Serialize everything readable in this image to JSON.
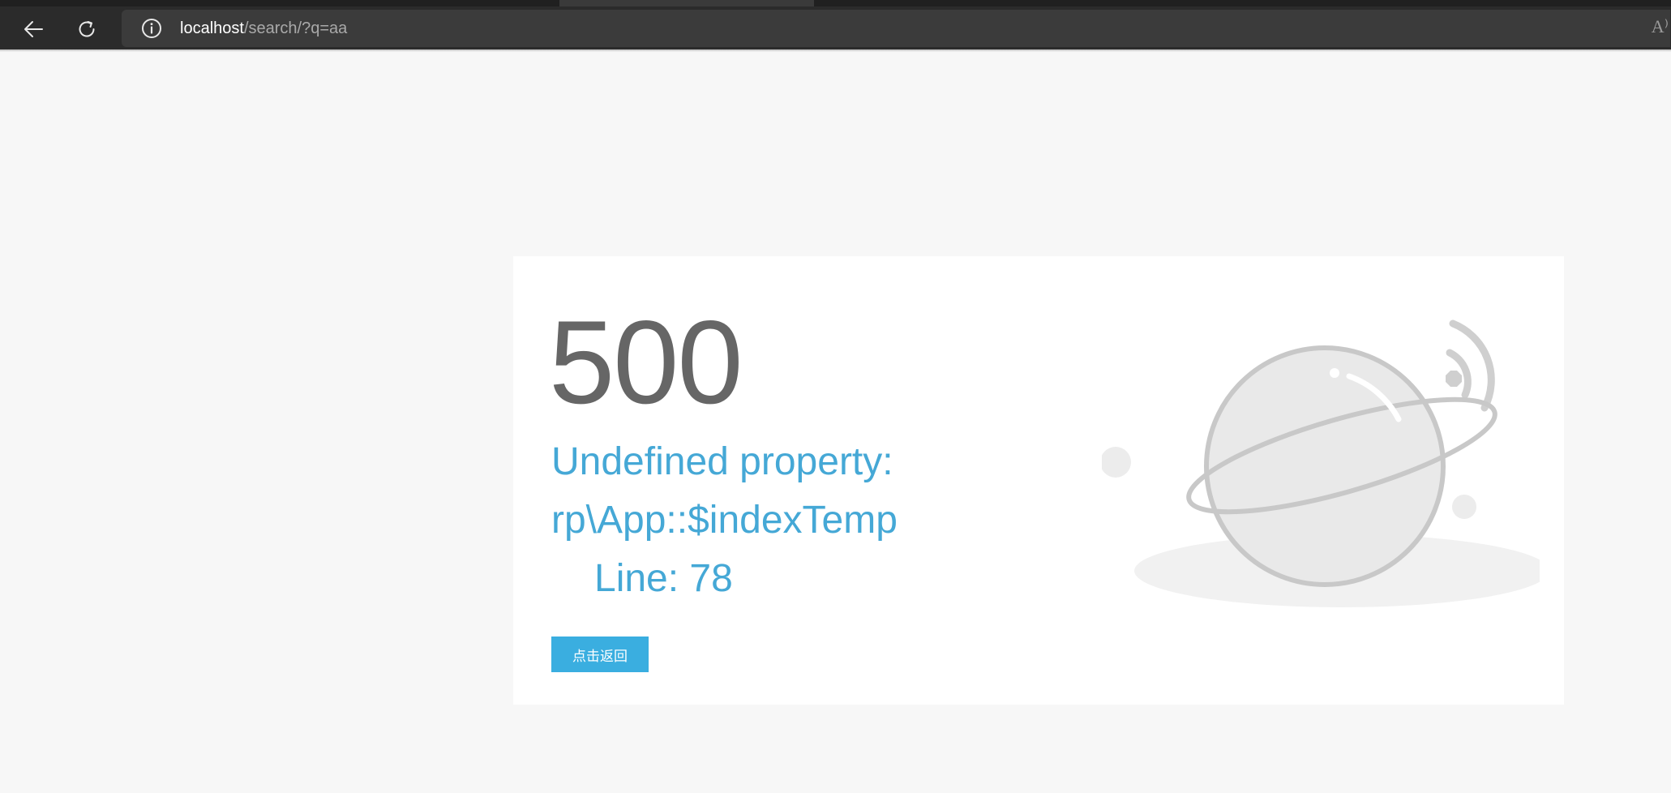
{
  "browser": {
    "url_host": "localhost",
    "url_path": "/search/?q=aa",
    "read_aloud_label": "A⁾"
  },
  "error": {
    "code": "500",
    "message_line1": "Undefined property:",
    "message_line2": "rp\\App::$indexTemp",
    "line_label": "Line: 78",
    "back_button_label": "点击返回"
  },
  "colors": {
    "accent": "#3aaee0",
    "message_text": "#45a8d6",
    "code_text": "#666666"
  },
  "icons": [
    "back-arrow-icon",
    "refresh-icon",
    "info-icon",
    "read-aloud-icon",
    "planet-illustration"
  ]
}
